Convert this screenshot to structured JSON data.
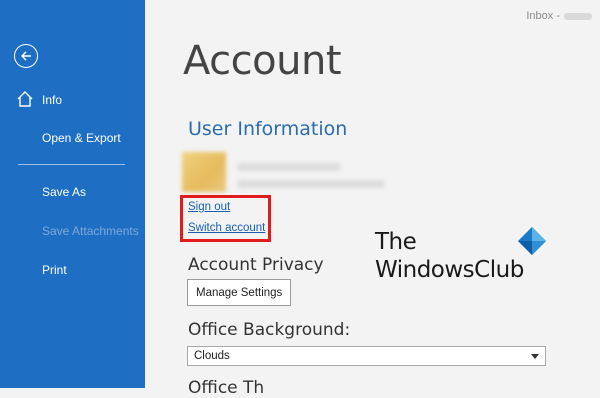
{
  "topbar": {
    "text": "Inbox -"
  },
  "sidebar": {
    "items": [
      {
        "label": "Info"
      },
      {
        "label": "Open & Export"
      },
      {
        "label": "Save As"
      },
      {
        "label": "Save Attachments"
      },
      {
        "label": "Print"
      }
    ]
  },
  "main": {
    "title": "Account",
    "user_info": {
      "heading": "User Information",
      "sign_out": "Sign out",
      "switch_account": "Switch account"
    },
    "privacy": {
      "heading": "Account Privacy",
      "button": "Manage Settings"
    },
    "background": {
      "heading": "Office Background:",
      "selected": "Clouds"
    },
    "next_heading_partial": "Office Th"
  },
  "watermark": {
    "line1": "The",
    "line2": "WindowsClub",
    "colors": [
      "#5bb4e8",
      "#1b79c9",
      "#2d8fd6",
      "#0e5fa8"
    ]
  },
  "colors": {
    "sidebar": "#1e6fc4",
    "accent_link": "#1a5fb4",
    "highlight": "#e21b1b"
  }
}
